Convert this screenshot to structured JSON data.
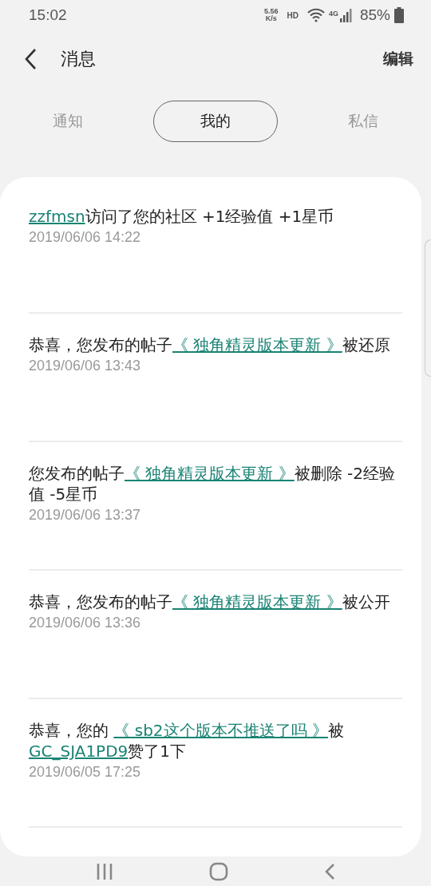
{
  "status_bar": {
    "time": "15:02",
    "speed_value": "5.56",
    "speed_unit": "K/s",
    "hd": "HD",
    "network": "4G",
    "battery": "85%"
  },
  "header": {
    "title": "消息",
    "action": "编辑"
  },
  "tabs": [
    {
      "label": "通知",
      "selected": false
    },
    {
      "label": "我的",
      "selected": true
    },
    {
      "label": "私信",
      "selected": false
    }
  ],
  "messages": [
    {
      "parts": [
        {
          "kind": "link",
          "text": "zzfmsn"
        },
        {
          "kind": "text",
          "text": "访问了您的社区 +1经验值 +1星币"
        }
      ],
      "time": "2019/06/06 14:22"
    },
    {
      "parts": [
        {
          "kind": "text",
          "text": "恭喜，您发布的帖子"
        },
        {
          "kind": "link",
          "text": "《 独角精灵版本更新 》"
        },
        {
          "kind": "text",
          "text": "被还原"
        }
      ],
      "time": "2019/06/06 13:43"
    },
    {
      "parts": [
        {
          "kind": "text",
          "text": "您发布的帖子"
        },
        {
          "kind": "link",
          "text": "《 独角精灵版本更新 》"
        },
        {
          "kind": "text",
          "text": "被删除 -2经验值 -5星币"
        }
      ],
      "time": "2019/06/06 13:37"
    },
    {
      "parts": [
        {
          "kind": "text",
          "text": "恭喜，您发布的帖子"
        },
        {
          "kind": "link",
          "text": "《 独角精灵版本更新 》"
        },
        {
          "kind": "text",
          "text": "被公开"
        }
      ],
      "time": "2019/06/06 13:36"
    },
    {
      "parts": [
        {
          "kind": "text",
          "text": "恭喜，您的 "
        },
        {
          "kind": "link",
          "text": "《 sb2这个版本不推送了吗 》"
        },
        {
          "kind": "text",
          "text": "被"
        },
        {
          "kind": "link",
          "text": "GC_SJA1PD9"
        },
        {
          "kind": "text",
          "text": "赞了1下"
        }
      ],
      "time": "2019/06/05 17:25"
    }
  ]
}
